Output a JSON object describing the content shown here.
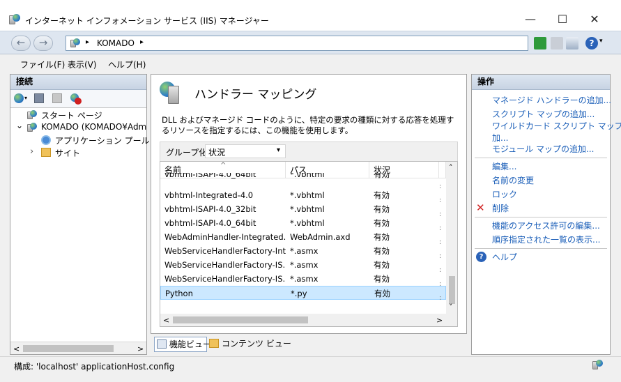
{
  "window": {
    "title": "インターネット インフォメーション サービス (IIS) マネージャー",
    "minimize_glyph": "—",
    "maximize_glyph": "☐",
    "close_glyph": "✕"
  },
  "address": {
    "back_glyph": "←",
    "forward_glyph": "→",
    "crumb_separator": "▸",
    "path": "KOMADO",
    "end_arrow": "▸",
    "help_glyph": "?"
  },
  "menu": [
    "ファイル(F)",
    "表示(V)",
    "ヘルプ(H)"
  ],
  "connections": {
    "header": "接続",
    "tree": [
      {
        "label": "スタート ページ",
        "expander": ""
      },
      {
        "label": "KOMADO (KOMADO¥Admin",
        "expander": "⌄"
      },
      {
        "label": "アプリケーション プール",
        "expander": ""
      },
      {
        "label": "サイト",
        "expander": "›"
      }
    ]
  },
  "feature": {
    "title": "ハンドラー マッピング",
    "description": "DLL およびマネージド コードのように、特定の要求の種類に対する応答を処理するリソースを指定するには、この機能を使用します。",
    "group_label": "グループ化:",
    "group_value": "状況",
    "group_arrow": "▾",
    "columns": [
      "名前",
      "パス",
      "状況",
      ""
    ],
    "rows": [
      {
        "name": "vbhtml-ISAPI-4.0_64bit",
        "path": "*.vbhtml",
        "state": "有効"
      },
      {
        "name": "vbhtml-Integrated-4.0",
        "path": "*.vbhtml",
        "state": "有効"
      },
      {
        "name": "vbhtml-ISAPI-4.0_32bit",
        "path": "*.vbhtml",
        "state": "有効"
      },
      {
        "name": "vbhtml-ISAPI-4.0_64bit",
        "path": "*.vbhtml",
        "state": "有効"
      },
      {
        "name": "WebAdminHandler-Integrated...",
        "path": "WebAdmin.axd",
        "state": "有効"
      },
      {
        "name": "WebServiceHandlerFactory-Int...",
        "path": "*.asmx",
        "state": "有効"
      },
      {
        "name": "WebServiceHandlerFactory-IS...",
        "path": "*.asmx",
        "state": "有効"
      },
      {
        "name": "WebServiceHandlerFactory-IS...",
        "path": "*.asmx",
        "state": "有効"
      },
      {
        "name": "Python",
        "path": "*.py",
        "state": "有効"
      }
    ],
    "scroll_up": "˄",
    "scroll_down": "˅",
    "scroll_left": "<",
    "scroll_right": ">",
    "sort_glyph": "^"
  },
  "view_tabs": {
    "features": "機能ビュー",
    "content": "コンテンツ ビュー"
  },
  "actions": {
    "header": "操作",
    "items": [
      "マネージド ハンドラーの追加...",
      "スクリプト マップの追加...",
      "ワイルドカード スクリプト マップの追加...",
      "モジュール マップの追加...",
      "編集...",
      "名前の変更",
      "ロック",
      "削除",
      "機能のアクセス許可の編集...",
      "順序指定された一覧の表示...",
      "ヘルプ"
    ],
    "wildcard_line1": "ワイルドカード スクリプト マップの追",
    "wildcard_line2": "加...",
    "delete_glyph": "✕",
    "help_glyph": "?"
  },
  "status": {
    "text": "構成: 'localhost' applicationHost.config"
  },
  "colors": {
    "link": "#1a5eb8",
    "selection": "#cce8ff",
    "delete_red": "#d02020"
  }
}
